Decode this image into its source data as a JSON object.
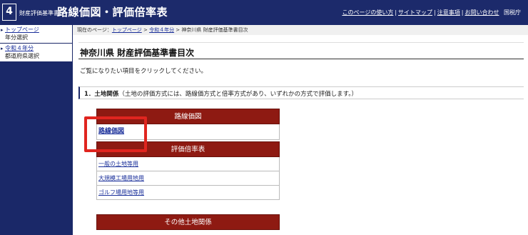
{
  "header": {
    "logo_number": "4",
    "logo_subtitle": "財産評価基準書",
    "title": "路線価図・評価倍率表",
    "links": [
      "このページの使い方",
      "サイトマップ",
      "注意事項",
      "お問い合わせ"
    ],
    "agency": "国税庁"
  },
  "sidebar": {
    "items": [
      {
        "link": "トップページ",
        "desc": "年分選択"
      },
      {
        "link": "令和４年分",
        "desc": "都道府県選択"
      }
    ]
  },
  "breadcrumb": {
    "prefix": "現在のページ：",
    "items": [
      "トップページ",
      "令和４年分"
    ],
    "current": "神奈川県 財産評価基準書目次"
  },
  "page": {
    "heading": "神奈川県  財産評価基準書目次",
    "intro": "ご覧になりたい項目をクリックしてください。",
    "section_label": "1．土地関係",
    "section_note": "（土地の評価方式には、路線価方式と倍率方式があり、いずれかの方式で評価します。）"
  },
  "tables": {
    "rosen": {
      "header": "路線価図",
      "rows": [
        "路線価図"
      ]
    },
    "hyoka": {
      "header": "評価倍率表",
      "rows": [
        "一般の土地等用",
        "大規模工場用地用",
        "ゴルフ場用地等用"
      ]
    },
    "other": {
      "header": "その他土地関係"
    }
  },
  "colors": {
    "header_bg": "#1c2a6b",
    "table_header": "#8e1a12",
    "link": "#1a2f9a",
    "highlight": "#e0251f"
  }
}
